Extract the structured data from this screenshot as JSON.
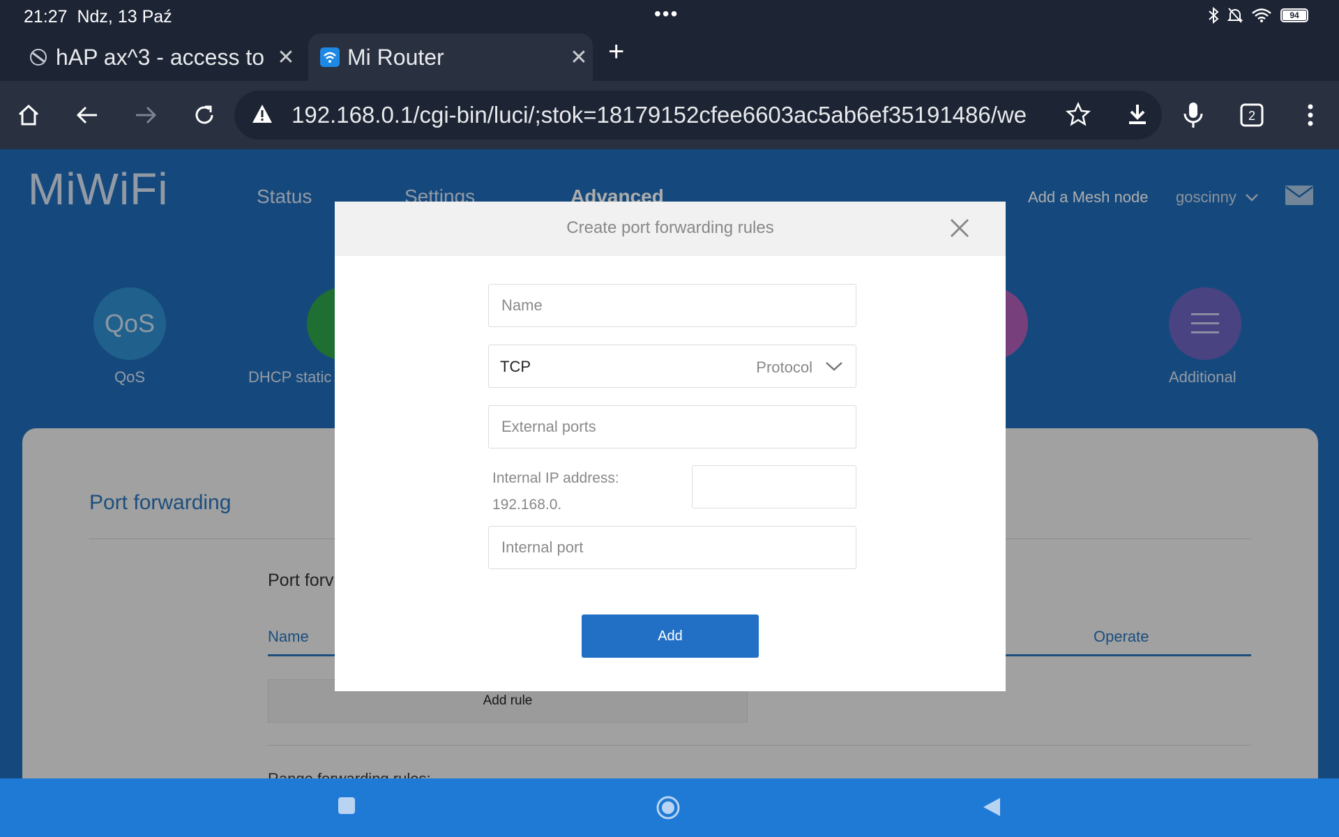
{
  "status_bar": {
    "time": "21:27",
    "date": "Ndz, 13 Paź",
    "more": "•••",
    "battery": "94"
  },
  "tabs": [
    {
      "label": "hAP ax^3 - access to"
    },
    {
      "label": "Mi Router"
    }
  ],
  "address_bar": {
    "url": "192.168.0.1/cgi-bin/luci/;stok=18179152cfee6603ac5ab6ef35191486/we",
    "tab_count": "2"
  },
  "page": {
    "logo": "MiWiFi",
    "nav": {
      "status": "Status",
      "settings": "Settings",
      "advanced": "Advanced"
    },
    "mesh": "Add a Mesh node",
    "user": "goscinny",
    "features": [
      {
        "icon_text": "QoS",
        "label": "QoS"
      },
      {
        "label": "DHCP static"
      },
      {
        "label": "Additional"
      }
    ],
    "section_title": "Port forwarding",
    "subsection": "Port forv",
    "table_headers": {
      "name": "Name",
      "operate": "Operate"
    },
    "add_rule": "Add rule",
    "range_title": "Range forwarding rules:"
  },
  "modal": {
    "title": "Create port forwarding rules",
    "name_placeholder": "Name",
    "protocol_value": "TCP",
    "protocol_label": "Protocol",
    "external_placeholder": "External ports",
    "internal_ip_label": "Internal IP address:",
    "internal_ip_prefix": "192.168.0.",
    "internal_port_placeholder": "Internal port",
    "add_button": "Add"
  },
  "colors": {
    "accent": "#2270c5",
    "page_bg": "#1f6cb8",
    "chrome_bg": "#1d2433"
  }
}
